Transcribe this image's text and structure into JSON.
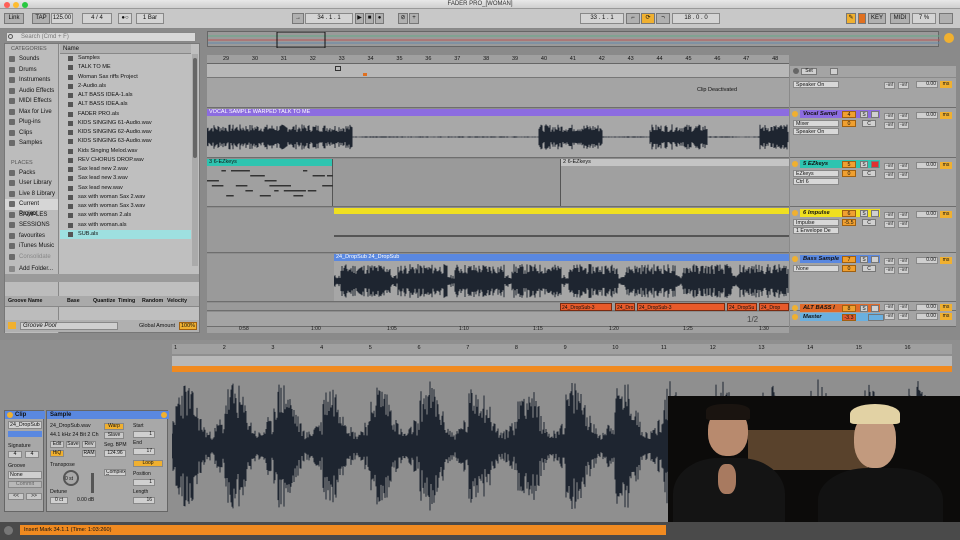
{
  "window": {
    "title": "FADER PRO_[WOMAN]"
  },
  "transport": {
    "link": "Link",
    "tap": "TAP",
    "tempo": "125.00",
    "signature": "4 / 4",
    "quantize": "1 Bar",
    "position": "34 . 1 . 1",
    "loop_start": "33 . 1 . 1",
    "loop_length": "18 . 0 . 0",
    "key": "KEY",
    "midi": "MIDI",
    "cpu": "7 %"
  },
  "browser": {
    "search_placeholder": "Search (Cmd + F)",
    "categories_header": "CATEGORIES",
    "name_header": "Name",
    "categories": [
      "Sounds",
      "Drums",
      "Instruments",
      "Audio Effects",
      "MIDI Effects",
      "Max for Live",
      "Plug-ins",
      "Clips",
      "Samples"
    ],
    "places_header": "PLACES",
    "places": [
      "Packs",
      "User Library",
      "Live 8 Library",
      "Current Project",
      "SAMPLES",
      "SESSIONS",
      "favourites",
      "iTunes Music",
      "Consolidate"
    ],
    "add_folder": "Add Folder...",
    "files": [
      "Samples",
      "TALK TO ME",
      "Woman Sax riffs Project",
      "2-Audio.als",
      "ALT BASS IDEA-1.als",
      "ALT BASS IDEA.als",
      "FADER PRO.als",
      "KIDS SINGING 61-Audio.wav",
      "KIDS SINGING 62-Audio.wav",
      "KIDS SINGING 63-Audio.wav",
      "Kids Singing Melod.wav",
      "REV CHORUS DROP.wav",
      "Sax lead new 2.wav",
      "Sax lead new 3.wav",
      "Sax lead new.wav",
      "sax with woman  Sax 2.wav",
      "sax with woman  Sax 3.wav",
      "sax with woman 2.als",
      "sax with woman.als",
      "SUB.als"
    ]
  },
  "groove": {
    "cols": [
      "Groove Name",
      "Base",
      "Quantize",
      "Timing",
      "Random",
      "Velocity"
    ],
    "pool": "Groove Pool",
    "global": "Global Amount",
    "global_val": "100%"
  },
  "ruler": [
    "29",
    "30",
    "31",
    "32",
    "33",
    "34",
    "35",
    "36",
    "37",
    "38",
    "39",
    "40",
    "41",
    "42",
    "43",
    "44",
    "45",
    "46",
    "47",
    "48"
  ],
  "time_ruler": [
    "0:58",
    "1:00",
    "1:05",
    "1:10",
    "1:15",
    "1:20",
    "1:25",
    "1:30"
  ],
  "arrangement": {
    "clip_deactivated": "Clip Deactivated",
    "vocal_clip": "VOCAL SAMPLE WARPED TALK TO ME",
    "ez1": "3 6-EZkeys",
    "ez2": "2 6-EZkeys",
    "bass1": "24_DropSub",
    "bass2": "24_DropSub",
    "red_clips": [
      "24_DropSub-3",
      "24_Dro",
      "24_DropSub-3",
      "24_DropSu",
      "24_Drop"
    ],
    "zoom": "1/2"
  },
  "mixer": {
    "set": "Set",
    "tracks": [
      {
        "name": "",
        "sel1": "Speaker On",
        "vol": "",
        "num": "",
        "color": "#9a9a9a"
      },
      {
        "name": "Vocal Sampl",
        "num": "4",
        "sel1": "Mixer",
        "sel2": "Speaker On",
        "vol": "0",
        "color": "#8c6ce0"
      },
      {
        "name": "5 EZkeys",
        "num": "5",
        "sel1": "EZkeys",
        "sel2": "Ctrl 6",
        "vol": "0",
        "color": "#2ec4b0"
      },
      {
        "name": "6 Impulse",
        "num": "6",
        "sel1": "Impulse",
        "sel2": "1 Envelope De",
        "vol": "-5.5",
        "color": "#f0e020"
      },
      {
        "name": "Bass Sample",
        "num": "7",
        "sel1": "None",
        "vol": "0",
        "color": "#5a88e0"
      },
      {
        "name": "ALT BASS I",
        "num": "8",
        "color": "#e06a2a"
      },
      {
        "name": "Master",
        "num": "-3.3",
        "color": "#6ab0e0"
      }
    ],
    "inf": "-inf",
    "send": "0.00",
    "ms": "ms",
    "c": "C",
    "s": "S"
  },
  "detail": {
    "clip_label": "Clip",
    "clip_name": "24_DropSub",
    "signature_label": "Signature",
    "sig_n": "4",
    "sig_d": "4",
    "groove_label": "Groove",
    "groove_val": "None",
    "commit": "Commit",
    "sample_label": "Sample",
    "sample_file": "24_DropSub.wav",
    "sample_info": "44.1 kHz 24 Bit 2 Ch",
    "edit": "Edit",
    "save": "Save",
    "rev": "Rev",
    "hiq": "HiQ",
    "ram": "RAM",
    "transpose": "Transpose",
    "transpose_val": "0 st",
    "detune": "Detune",
    "detune_val": "0 ct",
    "gain": "0.00 dB",
    "warp": "Warp",
    "slave": "Slave",
    "seg_bpm": "Seg. BPM",
    "bpm": "124.96",
    "complex": "Complex P",
    "start": "Start",
    "start_val": "1",
    "end": "End",
    "end_val": "17",
    "loop": "Loop",
    "position": "Position",
    "position_val": "1",
    "length": "Length",
    "length_val": "16",
    "ruler": [
      "1",
      "2",
      "3",
      "4",
      "5",
      "6",
      "7",
      "8",
      "9",
      "10",
      "11",
      "12",
      "13",
      "14",
      "15",
      "16"
    ]
  },
  "status": {
    "text": "Insert Mark 34.1.1 (Time: 1:03:260)"
  },
  "colors": {
    "vocal": "#8c6ce0",
    "ezkeys": "#2ec4b0",
    "impulse": "#f0e020",
    "bass": "#5a88e0",
    "alt": "#e85a2a",
    "master": "#6ab0e0",
    "orange": "#f08a20"
  }
}
